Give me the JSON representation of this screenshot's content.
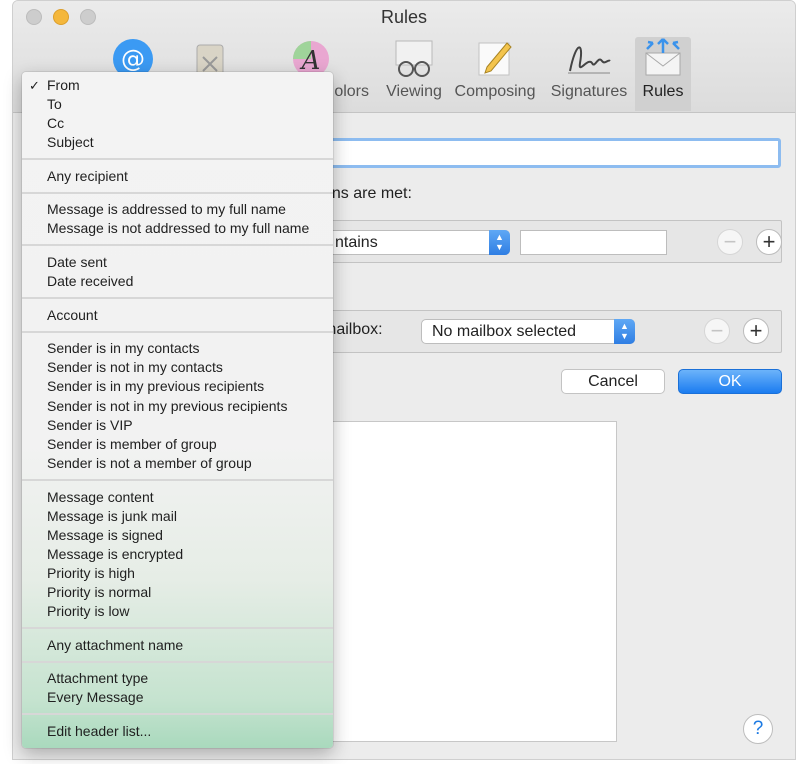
{
  "window": {
    "title": "Rules"
  },
  "toolbar": {
    "items": [
      {
        "label": "",
        "icon": "general-switch-icon"
      },
      {
        "label": "",
        "icon": "accounts-at-icon"
      },
      {
        "label": "",
        "icon": "junk-mail-icon"
      },
      {
        "label": "olors",
        "icon": "fonts-colors-icon"
      },
      {
        "label": "Viewing",
        "icon": "viewing-glasses-icon"
      },
      {
        "label": "Composing",
        "icon": "composing-pencil-icon"
      },
      {
        "label": "Signatures",
        "icon": "signature-icon"
      },
      {
        "label": "Rules",
        "icon": "rules-envelope-icon",
        "active": true
      }
    ]
  },
  "sheet": {
    "conditions_label": "ons are met:",
    "condition_popup": "ntains",
    "action_label": "mailbox:",
    "mailbox_popup": "No mailbox selected",
    "cancel_label": "Cancel",
    "ok_label": "OK"
  },
  "help": {
    "label": "?"
  },
  "menu": {
    "checkmark": "✓",
    "groups": [
      [
        "From",
        "To",
        "Cc",
        "Subject"
      ],
      [
        "Any recipient"
      ],
      [
        "Message is addressed to my full name",
        "Message is not addressed to my full name"
      ],
      [
        "Date sent",
        "Date received"
      ],
      [
        "Account"
      ],
      [
        "Sender is in my contacts",
        "Sender is not in my contacts",
        "Sender is in my previous recipients",
        "Sender is not in my previous recipients",
        "Sender is VIP",
        "Sender is member of group",
        "Sender is not a member of group"
      ],
      [
        "Message content",
        "Message is junk mail",
        "Message is signed",
        "Message is encrypted",
        "Priority is high",
        "Priority is normal",
        "Priority is low"
      ],
      [
        "Any attachment name"
      ],
      [
        "Attachment type",
        "Every Message"
      ],
      [
        "Edit header list..."
      ]
    ]
  },
  "colors": {
    "accent": "#2f7ee3",
    "focus_ring": "#8dbcf0",
    "minimize": "#f4b73c"
  }
}
